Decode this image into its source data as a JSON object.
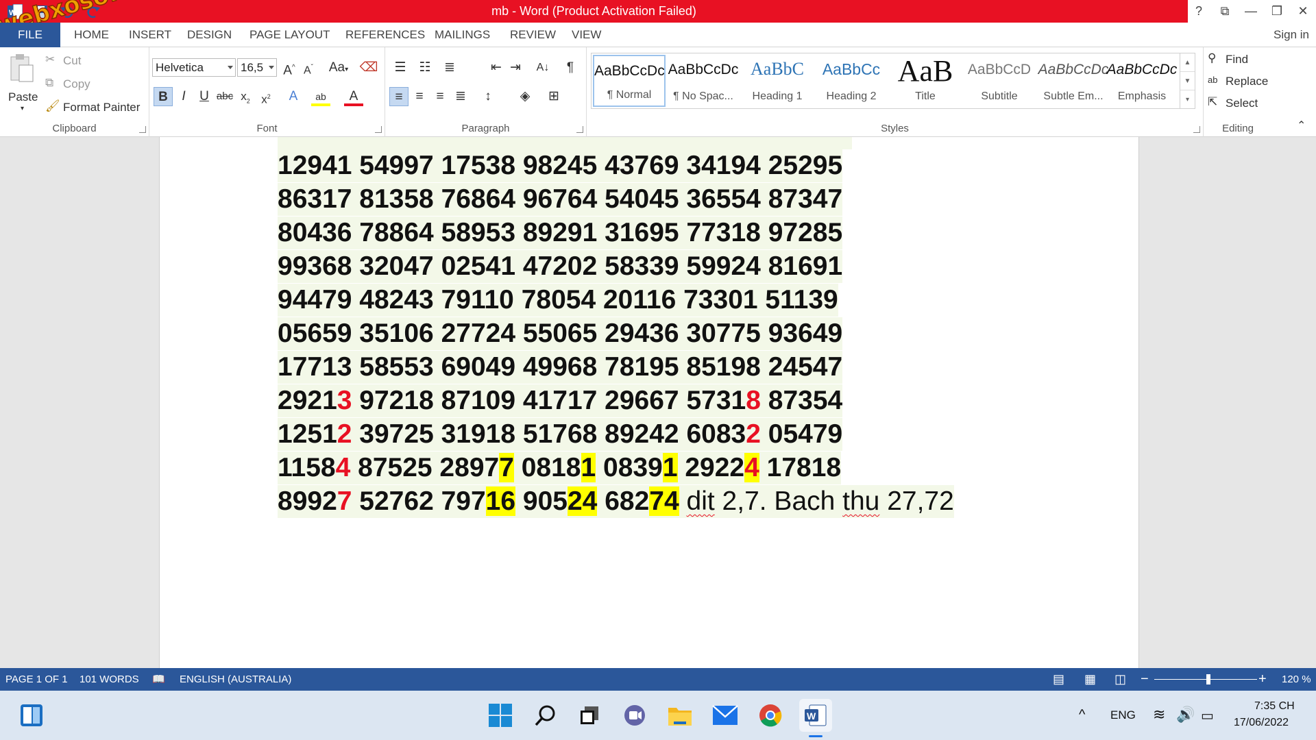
{
  "window": {
    "title": "mb -  Word (Product Activation Failed)",
    "controls": [
      "?",
      "⧉",
      "—",
      "❐",
      "✕"
    ]
  },
  "watermark": "webxoso.net",
  "tabs": [
    "FILE",
    "HOME",
    "INSERT",
    "DESIGN",
    "PAGE LAYOUT",
    "REFERENCES",
    "MAILINGS",
    "REVIEW",
    "VIEW"
  ],
  "signin": "Sign in",
  "clipboard": {
    "paste": "Paste",
    "cut": "Cut",
    "copy": "Copy",
    "format_painter": "Format Painter",
    "label": "Clipboard"
  },
  "font": {
    "name": "Helvetica",
    "size": "16,5",
    "label": "Font",
    "case": "Aa"
  },
  "paragraph": {
    "label": "Paragraph"
  },
  "styles": {
    "label": "Styles",
    "items": [
      {
        "sample": "AaBbCcDc",
        "name": "¶ Normal"
      },
      {
        "sample": "AaBbCcDc",
        "name": "¶ No Spac..."
      },
      {
        "sample": "AaBbC",
        "name": "Heading 1"
      },
      {
        "sample": "AaBbCc",
        "name": "Heading 2"
      },
      {
        "sample": "AaB",
        "name": "Title"
      },
      {
        "sample": "AaBbCcD",
        "name": "Subtitle"
      },
      {
        "sample": "AaBbCcDc",
        "name": "Subtle Em..."
      },
      {
        "sample": "AaBbCcDc",
        "name": "Emphasis"
      }
    ]
  },
  "editing": {
    "find": "Find",
    "replace": "Replace",
    "select": "Select",
    "label": "Editing"
  },
  "document": {
    "lines": [
      "12941 54997 17538 98245 43769 34194 25295",
      "86317 81358 76864 96764 54045 36554 87347",
      "80436 78864 58953 89291 31695 77318 97285",
      "99368 32047 02541 47202 58339 59924 81691",
      "94479 48243 79110 78054 20116 73301 51139",
      "05659 35106 27724 55065 29436 30775 93649",
      "17713 58553 69049 49968 78195 85198 24547"
    ],
    "line8": {
      "a": "2921",
      "b": "3",
      "c": " 97218 87109 41717 29667 5731",
      "d": "8",
      "e": " 87354"
    },
    "line9": {
      "a": "1251",
      "b": "2",
      "c": " 39725 31918 51768 89242 6083",
      "d": "2",
      "e": " 05479"
    },
    "line10": {
      "a": "1158",
      "b": "4",
      "c": " 87525 2897",
      "d": "7",
      "e": " 0818",
      "f": "1",
      "g": " 0839",
      "h": "1",
      "i": " 2922",
      "j": "4",
      "k": " 17818"
    },
    "line11": {
      "a": "8992",
      "b": "7",
      "c": " 52762 797",
      "d": "16",
      "e": " 905",
      "f": "24",
      "g": " 682",
      "h": "74",
      "i": " ",
      "j": "dit",
      "k": " 2,7. Bach ",
      "l": "thu",
      "m": " 27,72"
    }
  },
  "status": {
    "page": "PAGE 1 OF 1",
    "words": "101 WORDS",
    "language": "ENGLISH (AUSTRALIA)",
    "zoom": "120 %",
    "zoom_level_percent": 120
  },
  "taskbar": {
    "lang": "ENG",
    "time": "7:35 CH",
    "date": "17/06/2022"
  }
}
